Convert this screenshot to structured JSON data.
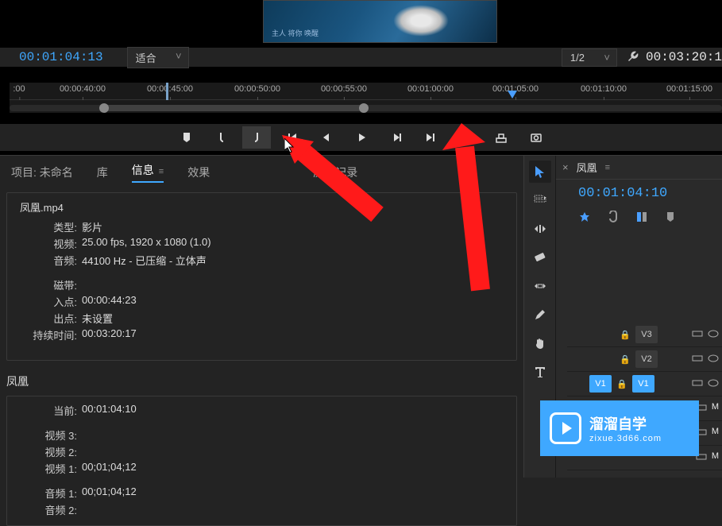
{
  "monitor": {
    "preview_text": "主人 将你 唤醒",
    "timecode_left": "00:01:04:13",
    "fit_label": "适合",
    "ratio_label": "1/2",
    "timecode_right": "00:03:20:1",
    "ruler_ticks": [
      ":00",
      "00:00:40:00",
      "00:00:45:00",
      "00:00:50:00",
      "00:00:55:00",
      "00:01:00:00",
      "00:01:05:00",
      "00:01:10:00",
      "00:01:15:00"
    ]
  },
  "panel_tabs": {
    "project": "项目: 未命名",
    "library": "库",
    "info": "信息",
    "effects": "效果",
    "history": "历史记录"
  },
  "clip": {
    "filename": "凤凰.mp4",
    "type_label": "类型:",
    "type": "影片",
    "video_label": "视频:",
    "video": "25.00 fps, 1920 x 1080 (1.0)",
    "audio_label": "音频:",
    "audio": "44100 Hz - 已压缩 - 立体声",
    "tape_label": "磁带:",
    "tape": "",
    "in_label": "入点:",
    "in": "00:00:44:23",
    "out_label": "出点:",
    "out": "未设置",
    "dur_label": "持续时间:",
    "dur": "00:03:20:17"
  },
  "sequence": {
    "name": "凤凰",
    "current_label": "当前:",
    "current": "00:01:04:10",
    "v3_label": "视频 3:",
    "v3": "",
    "v2_label": "视频 2:",
    "v2": "",
    "v1_label": "视频 1:",
    "v1": "00;01;04;12",
    "a1_label": "音频 1:",
    "a1": "00;01;04;12",
    "a2_label": "音频 2:",
    "a2": ""
  },
  "timeline": {
    "tab_title": "凤凰",
    "timecode": "00:01:04:10",
    "tracks": {
      "v3": "V3",
      "v2": "V2",
      "v1": "V1",
      "v1_src": "V1",
      "m1": "M",
      "m2": "M",
      "m3": "M"
    }
  },
  "watermark": {
    "main": "溜溜自学",
    "sub": "zixue.3d66.com"
  }
}
